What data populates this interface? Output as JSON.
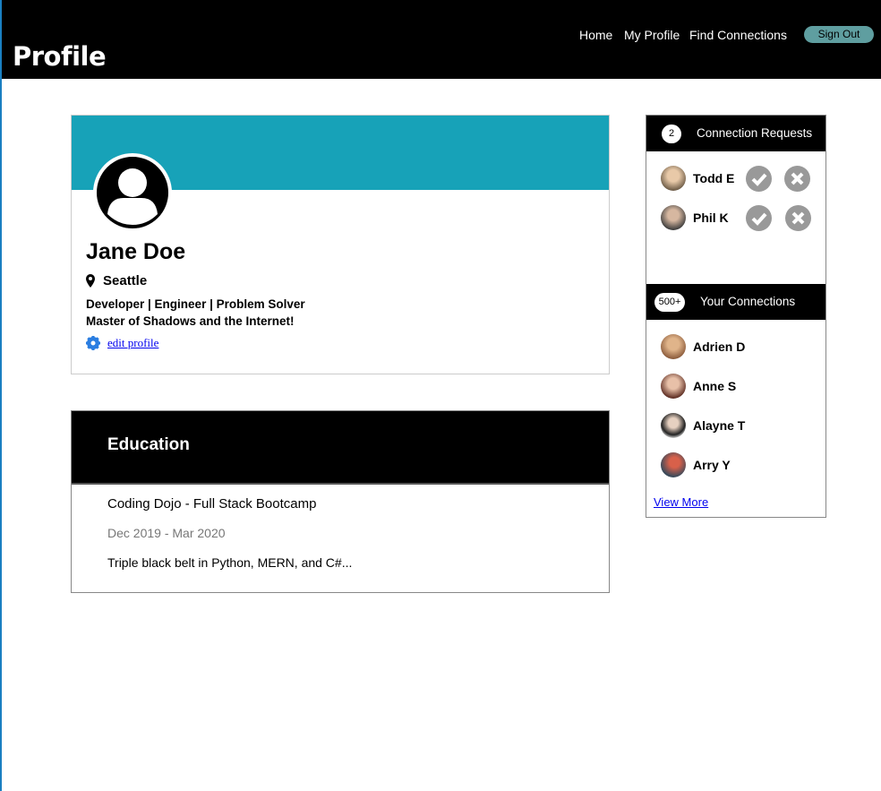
{
  "header": {
    "brand": "Profile",
    "nav": [
      "Home",
      "My Profile",
      "Find Connections"
    ],
    "signout": "Sign Out"
  },
  "profile": {
    "name": "Jane Doe",
    "location": "Seattle",
    "tagline": "Developer | Engineer | Problem Solver",
    "bio": "Master of Shadows and the Internet!",
    "edit_label": "edit profile",
    "banner_color": "#17a2b8"
  },
  "education": {
    "title": "Education",
    "school": "Coding Dojo - Full Stack Bootcamp",
    "dates": "Dec 2019 - Mar 2020",
    "description": "Triple black belt in Python, MERN, and C#..."
  },
  "requests": {
    "count": "2",
    "title": "Connection Requests",
    "items": [
      {
        "name": "Todd E"
      },
      {
        "name": "Phil K"
      }
    ]
  },
  "connections": {
    "count": "500+",
    "title": "Your Connections",
    "items": [
      {
        "name": "Adrien D"
      },
      {
        "name": "Anne S"
      },
      {
        "name": "Alayne T"
      },
      {
        "name": "Arry Y"
      }
    ],
    "view_more": "View More"
  }
}
